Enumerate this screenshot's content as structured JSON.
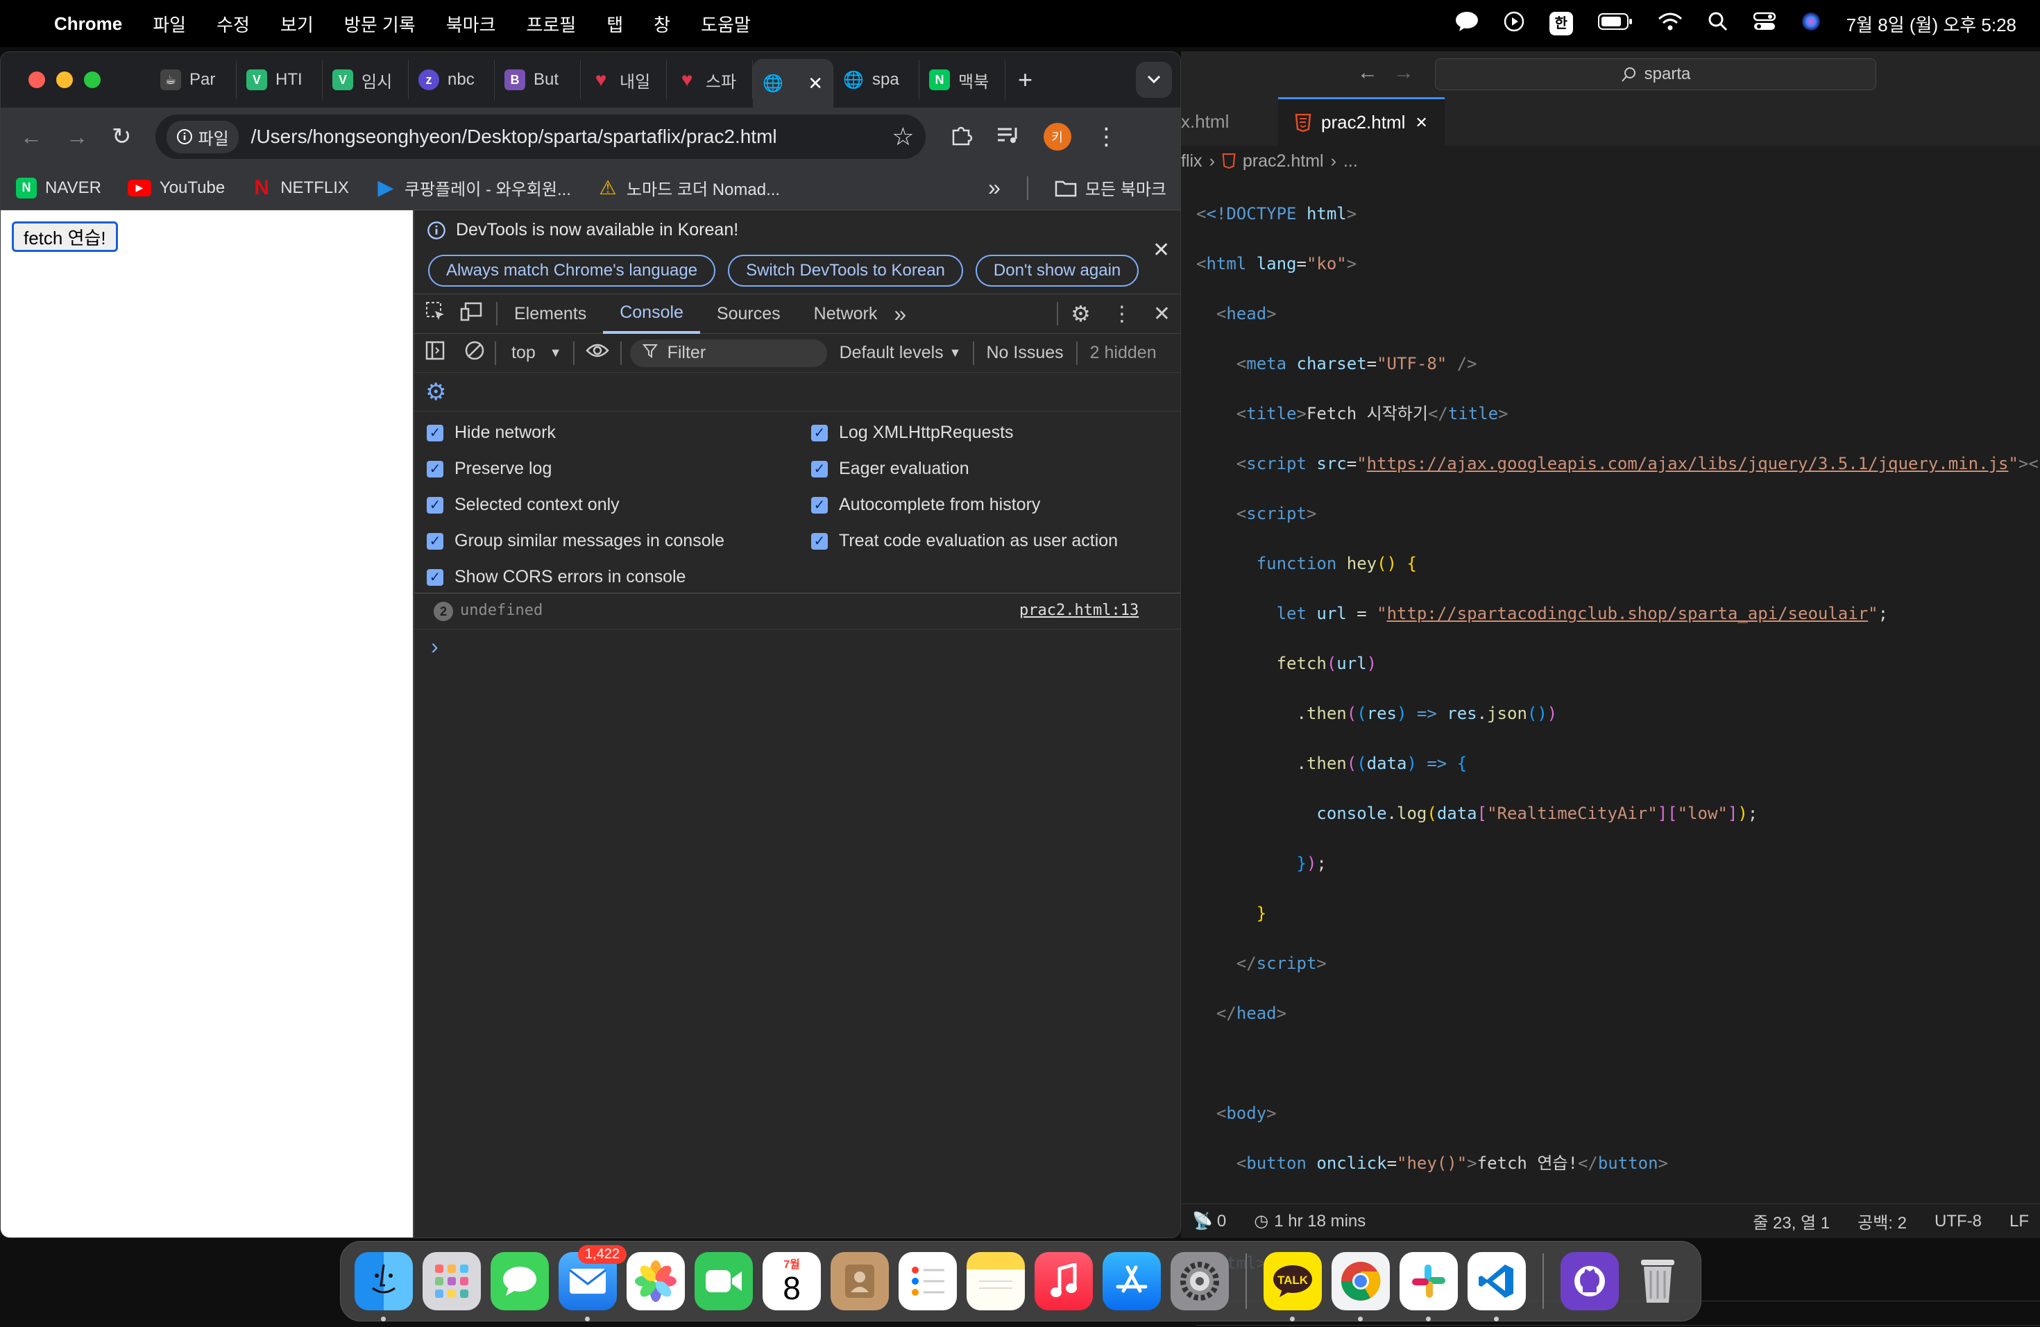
{
  "menubar": {
    "app": "Chrome",
    "items": [
      "파일",
      "수정",
      "보기",
      "방문 기록",
      "북마크",
      "프로필",
      "탭",
      "창",
      "도움말"
    ],
    "input_indicator": "한",
    "datetime": "7월 8일 (월) 오후 5:28"
  },
  "chrome": {
    "tabs": [
      {
        "label": "Par",
        "color": "#444444",
        "glyph": "☕"
      },
      {
        "label": "HTI",
        "color": "#2bb673",
        "glyph": "V"
      },
      {
        "label": "임시",
        "color": "#2bb673",
        "glyph": "V"
      },
      {
        "label": "nbc",
        "color": "#5a4bd1",
        "glyph": "z"
      },
      {
        "label": "But",
        "color": "#7952b3",
        "glyph": "B"
      },
      {
        "label": "내일",
        "color": "#e0344f",
        "glyph": "♥"
      },
      {
        "label": "스파",
        "color": "#e0344f",
        "glyph": "♥"
      },
      {
        "label": "",
        "color": "#5f6368",
        "glyph": "🌐"
      },
      {
        "label": "spa",
        "color": "#5f6368",
        "glyph": "🌐"
      },
      {
        "label": "맥북",
        "color": "#03c75a",
        "glyph": "N"
      }
    ],
    "tab_close": "✕",
    "new_tab": "+",
    "address": {
      "security_label": "파일",
      "url": "/Users/hongseonghyeon/Desktop/sparta/spartaflix/prac2.html"
    },
    "profile_initial": "키",
    "bookmarks": [
      {
        "label": "NAVER",
        "color": "#03c75a",
        "glyph": "N"
      },
      {
        "label": "YouTube",
        "color": "#ff0000",
        "glyph": "▶"
      },
      {
        "label": "NETFLIX",
        "color": "#e50914",
        "glyph": "N"
      },
      {
        "label": "쿠팡플레이 - 와우회원...",
        "color": "#1e88e5",
        "glyph": "▶"
      },
      {
        "label": "노마드 코더 Nomad...",
        "color": "#f5b400",
        "glyph": "⚠"
      }
    ],
    "bookmarks_more": "»",
    "all_bookmarks": "모든 북마크"
  },
  "page": {
    "button_label": "fetch 연습!"
  },
  "devtools": {
    "banner": {
      "message": "DevTools is now available in Korean!",
      "buttons": [
        "Always match Chrome's language",
        "Switch DevTools to Korean",
        "Don't show again"
      ]
    },
    "tabs": [
      "Elements",
      "Console",
      "Sources",
      "Network"
    ],
    "active_tab": "Console",
    "console_toolbar": {
      "context": "top",
      "filter_placeholder": "Filter",
      "levels": "Default levels",
      "issues": "No Issues",
      "hidden": "2 hidden"
    },
    "settings": [
      {
        "label": "Hide network",
        "checked": true
      },
      {
        "label": "Log XMLHttpRequests",
        "checked": true
      },
      {
        "label": "Preserve log",
        "checked": true
      },
      {
        "label": "Eager evaluation",
        "checked": true
      },
      {
        "label": "Selected context only",
        "checked": true
      },
      {
        "label": "Autocomplete from history",
        "checked": true
      },
      {
        "label": "Group similar messages in console",
        "checked": true
      },
      {
        "label": "Treat code evaluation as user action",
        "checked": true
      },
      {
        "label": "Show CORS errors in console",
        "checked": true
      }
    ],
    "message": {
      "count": "2",
      "text": "undefined",
      "source": "prac2.html:13"
    },
    "prompt": "›"
  },
  "editor": {
    "search": "sparta",
    "tabs": [
      {
        "label": "x.html",
        "active": false
      },
      {
        "label": "prac2.html",
        "active": true
      }
    ],
    "tab_close": "✕",
    "breadcrumb": [
      "flix",
      "prac2.html",
      "..."
    ],
    "code": {
      "l1_doctype": "<!DOCTYPE",
      "l1_html": "html",
      "l2_lang_val": "\"ko\"",
      "l4_charset_val": "\"UTF-8\"",
      "l5_title": "Fetch 시작하기",
      "l6_src": "https://ajax.googleapis.com/ajax/libs/jquery/3.5.1/jquery.min.js",
      "l8_fn": "hey",
      "l9_url": "http://spartacodingclub.shop/sparta_api/seoulair",
      "l13_key1": "\"RealtimeCityAir\"",
      "l13_key2": "\"low\"",
      "l19_onclick": "\"hey()\"",
      "l19_text": "fetch 연습!"
    },
    "status": {
      "ports": "0",
      "time": "1 hr 18 mins",
      "cursor": "줄 23, 열 1",
      "indent": "공백: 2",
      "encoding": "UTF-8",
      "eol": "LF"
    }
  },
  "dock": {
    "mail_badge": "1,422",
    "calendar_month": "7월",
    "calendar_day": "8",
    "talk_label": "TALK"
  }
}
